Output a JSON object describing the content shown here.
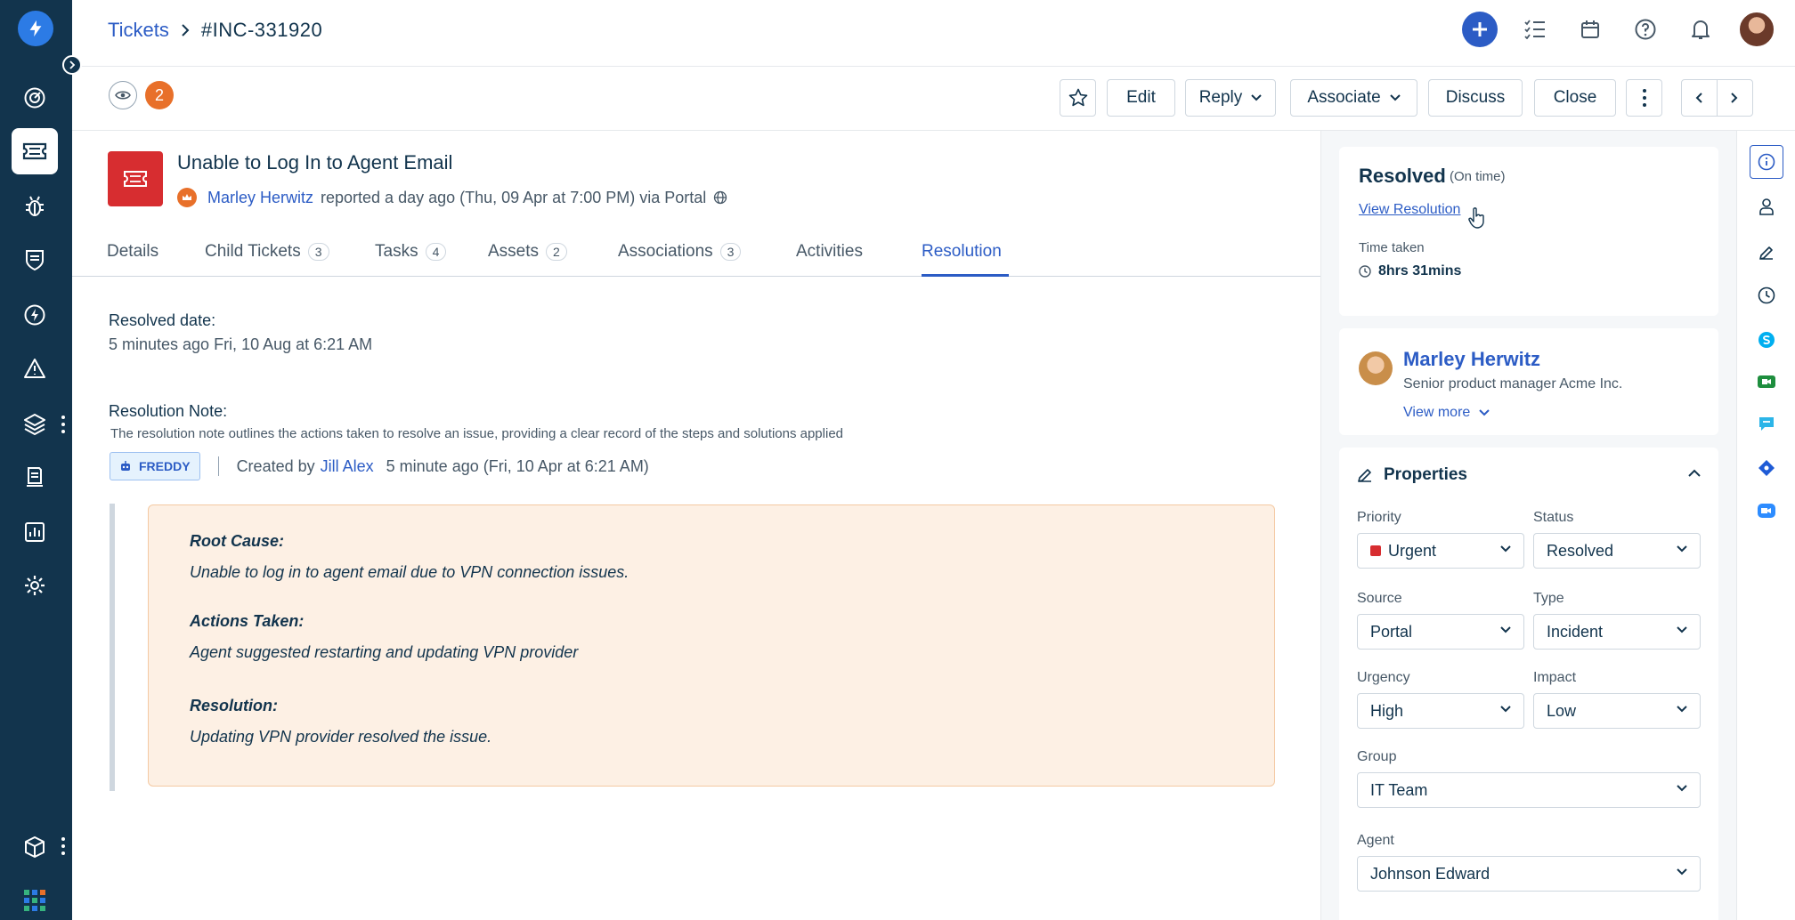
{
  "breadcrumb": {
    "parent": "Tickets",
    "current": "#INC-331920"
  },
  "watchers": {
    "count": "2"
  },
  "actions": {
    "edit": "Edit",
    "reply": "Reply",
    "associate": "Associate",
    "discuss": "Discuss",
    "close": "Close"
  },
  "ticket": {
    "title": "Unable to Log In to Agent Email",
    "requester": "Marley Herwitz",
    "meta": "reported a day ago (Thu, 09 Apr at 7:00 PM) via Portal"
  },
  "tabs": [
    {
      "label": "Details",
      "count": ""
    },
    {
      "label": "Child Tickets",
      "count": "3"
    },
    {
      "label": "Tasks",
      "count": "4"
    },
    {
      "label": "Assets",
      "count": "2"
    },
    {
      "label": "Associations",
      "count": "3"
    },
    {
      "label": "Activities",
      "count": ""
    },
    {
      "label": "Resolution",
      "count": ""
    }
  ],
  "resolution": {
    "date_label": "Resolved date:",
    "date_value": "5 minutes ago Fri, 10 Aug at 6:21 AM",
    "note_label": "Resolution Note:",
    "note_desc": "The resolution note outlines the actions taken to resolve an issue, providing a clear record of the steps and solutions applied",
    "freddy": "FREDDY",
    "created_by": "Created by",
    "creator": "Jill Alex",
    "created_when": "5 minute ago (Fri, 10 Apr at 6:21 AM)",
    "root_cause_h": "Root Cause:",
    "root_cause": "Unable to log in to agent email due to VPN connection issues.",
    "actions_h": "Actions Taken:",
    "actions": "Agent suggested restarting and updating VPN provider",
    "resolution_h": "Resolution:",
    "resolution": "Updating VPN provider resolved the issue."
  },
  "status_card": {
    "status": "Resolved",
    "sla": "(On time)",
    "view_resolution": "View Resolution",
    "time_taken_label": "Time taken",
    "time_taken": "8hrs 31mins"
  },
  "requester_card": {
    "name": "Marley Herwitz",
    "role": "Senior product manager Acme Inc.",
    "view_more": "View more"
  },
  "properties": {
    "title": "Properties",
    "priority_label": "Priority",
    "priority": "Urgent",
    "status_label": "Status",
    "status": "Resolved",
    "source_label": "Source",
    "source": "Portal",
    "type_label": "Type",
    "type": "Incident",
    "urgency_label": "Urgency",
    "urgency": "High",
    "impact_label": "Impact",
    "impact": "Low",
    "group_label": "Group",
    "group": "IT Team",
    "agent_label": "Agent",
    "agent": "Johnson Edward"
  },
  "colors": {
    "nav_bg": "#12344d",
    "link": "#2c5cc5",
    "priority_urgent": "#d72d30",
    "note_bg": "#fdf0e4",
    "badge": "#e8702a"
  }
}
